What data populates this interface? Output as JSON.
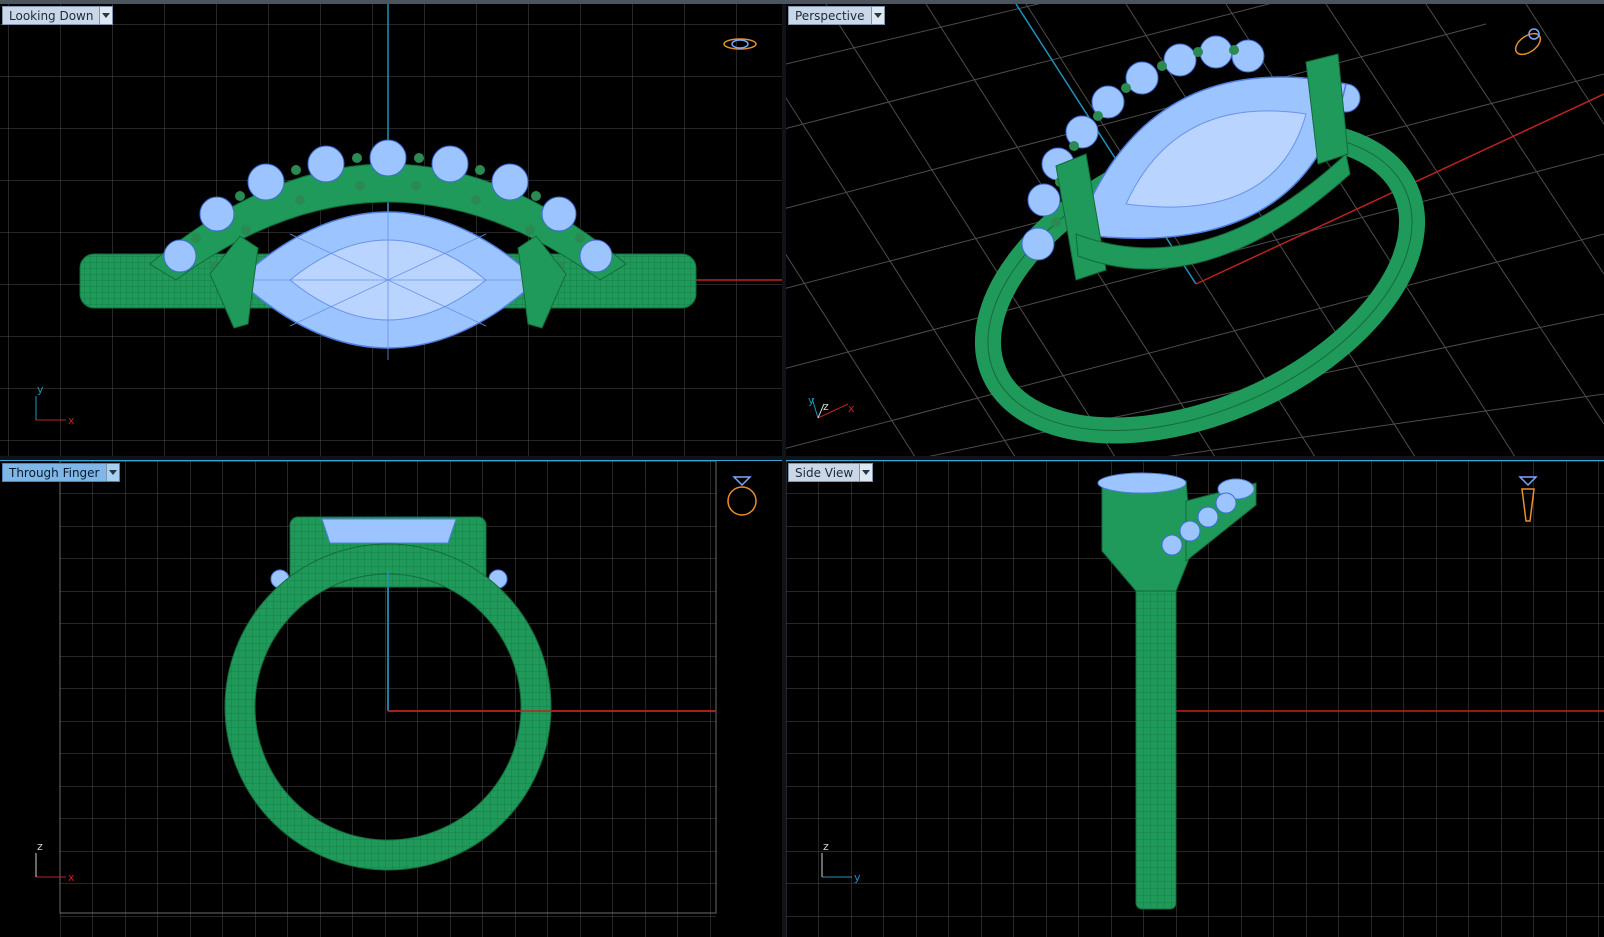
{
  "viewports": {
    "top": {
      "label": "Looking Down",
      "axis_h": "x",
      "axis_v": "y"
    },
    "persp": {
      "label": "Perspective",
      "axis_h": "x",
      "axis_v": "y",
      "axis_z": "z"
    },
    "front": {
      "label": "Through Finger",
      "axis_h": "x",
      "axis_v": "z"
    },
    "side": {
      "label": "Side View",
      "axis_h": "y",
      "axis_v": "z"
    }
  },
  "colors": {
    "background": "#000000",
    "grid": "#5a5a5a",
    "metal": "#1f9a5a",
    "stone": "#9cc4ff",
    "x_axis": "#c0221e",
    "y_axis": "#1f93b8",
    "gizmo": "#e8902a"
  }
}
